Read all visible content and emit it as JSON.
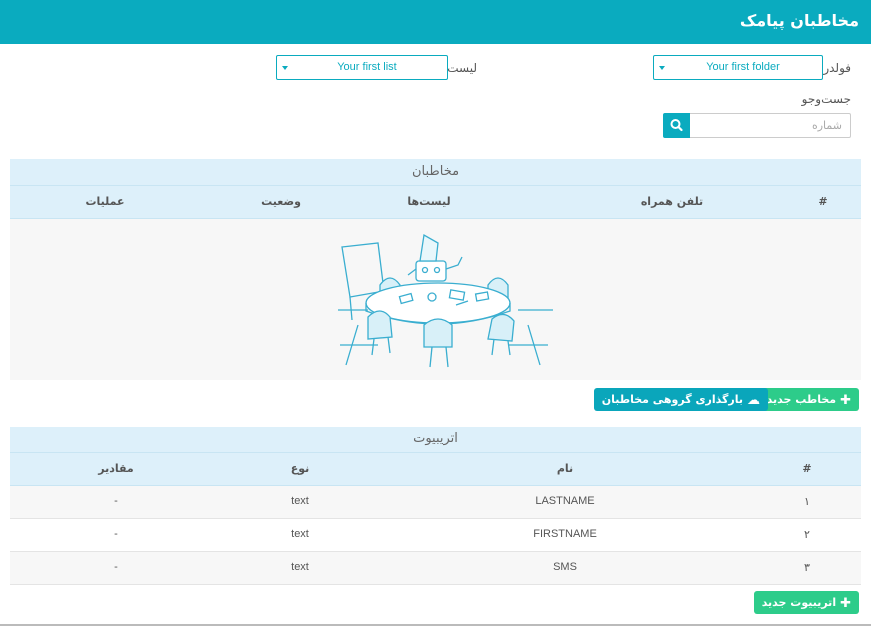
{
  "header": {
    "title": "مخاطبان پیامک"
  },
  "filters": {
    "folder_label": "فولدر",
    "folder_value": "Your first folder",
    "list_label": "لیست",
    "list_value": "Your first list",
    "search_label": "جست‌وجو",
    "search_placeholder": "شماره",
    "search_icon": "search-icon"
  },
  "contacts": {
    "title": "مخاطبان",
    "columns": [
      "#",
      "تلفن همراه",
      "لیست‌ها",
      "وضعیت",
      "عملیات"
    ],
    "empty_illustration": "robot-meeting-table"
  },
  "actions": {
    "new_contact": "مخاطب جدید",
    "group_upload": "بارگذاری گروهی مخاطبان"
  },
  "attributes": {
    "title": "اتریبیوت",
    "columns": [
      "#",
      "نام",
      "نوع",
      "مقادیر"
    ],
    "rows": [
      {
        "num": "۱",
        "name": "LASTNAME",
        "type": "text",
        "values": "-"
      },
      {
        "num": "۲",
        "name": "FIRSTNAME",
        "type": "text",
        "values": "-"
      },
      {
        "num": "۳",
        "name": "SMS",
        "type": "text",
        "values": "-"
      }
    ],
    "new_attribute": "اتریبیوت جدید"
  },
  "colors": {
    "primary": "#0aabbf",
    "success": "#2dcc8a",
    "header_bg": "#ddf0fa"
  }
}
